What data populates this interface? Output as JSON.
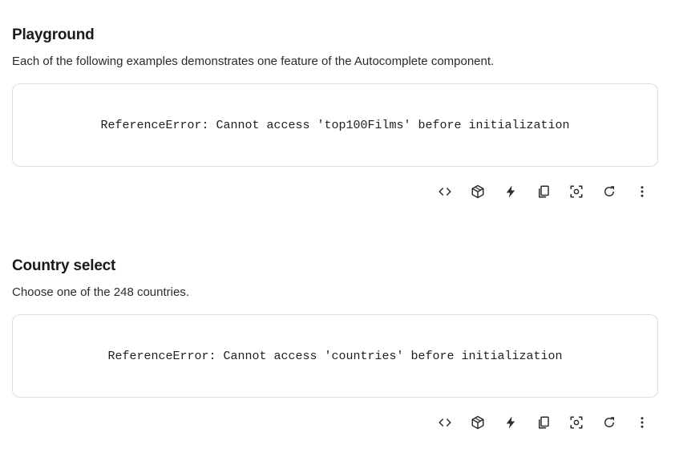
{
  "sections": [
    {
      "title": "Playground",
      "description": "Each of the following examples demonstrates one feature of the Autocomplete component.",
      "error": "ReferenceError: Cannot access 'top100Films' before initialization",
      "toolbar": [
        "code-icon",
        "cube-icon",
        "bolt-icon",
        "copy-icon",
        "fullscreen-icon",
        "refresh-icon",
        "more-vert-icon"
      ]
    },
    {
      "title": "Country select",
      "description": "Choose one of the 248 countries.",
      "error": "ReferenceError: Cannot access 'countries' before initialization",
      "toolbar": [
        "code-icon",
        "cube-icon",
        "bolt-icon",
        "copy-icon",
        "fullscreen-icon",
        "refresh-icon",
        "more-vert-icon"
      ]
    }
  ],
  "colors": {
    "text": "#1f1f1f",
    "border": "#dadde3",
    "icon": "#2d2d2d"
  }
}
